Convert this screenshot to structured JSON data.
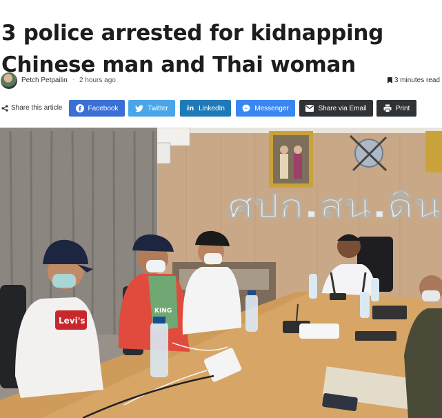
{
  "article": {
    "headline": "3 police arrested for kidnapping Chinese man and Thai woman",
    "author": "Petch Petpailin",
    "separator": "·",
    "time_ago": "2 hours ago",
    "read_time": "3 minutes read"
  },
  "share": {
    "label": "Share this article",
    "buttons": {
      "facebook": "Facebook",
      "twitter": "Twitter",
      "linkedin": "LinkedIn",
      "messenger": "Messenger",
      "email": "Share via Email",
      "print": "Print"
    }
  },
  "photo": {
    "sign_text": "ศปก.สน.ดิน",
    "tshirt_text": "Levi's",
    "shirt_text": "KING"
  },
  "colors": {
    "facebook": "#3b6fd6",
    "twitter": "#4aa6e8",
    "linkedin": "#1f7bb8",
    "messenger": "#3a87f2",
    "dark": "#2f3336"
  }
}
